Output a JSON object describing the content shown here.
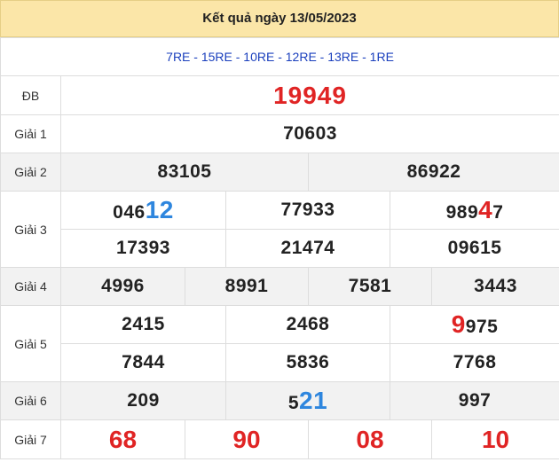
{
  "header": {
    "title": "Kết quả ngày 13/05/2023"
  },
  "codes": "7RE - 15RE - 10RE - 12RE - 13RE - 1RE",
  "prizes": {
    "db": {
      "label": "ĐB",
      "value": "19949"
    },
    "g1": {
      "label": "Giải 1",
      "value": "70603"
    },
    "g2": {
      "label": "Giải 2",
      "values": [
        "83105",
        "86922"
      ]
    },
    "g3": {
      "label": "Giải 3",
      "row1": [
        {
          "main": "046",
          "hl": "12"
        },
        {
          "main": "77933"
        },
        {
          "pre": "989",
          "hl": "4",
          "post": "7"
        }
      ],
      "row2": [
        "17393",
        "21474",
        "09615"
      ]
    },
    "g4": {
      "label": "Giải 4",
      "values": [
        "4996",
        "8991",
        "7581",
        "3443"
      ]
    },
    "g5": {
      "label": "Giải 5",
      "row1": [
        {
          "main": "2415"
        },
        {
          "main": "2468"
        },
        {
          "hl": "9",
          "post": "975"
        }
      ],
      "row2": [
        "7844",
        "5836",
        "7768"
      ]
    },
    "g6": {
      "label": "Giải 6",
      "values": [
        {
          "main": "209"
        },
        {
          "main": "5",
          "hl": "21"
        },
        {
          "main": "997"
        }
      ]
    },
    "g7": {
      "label": "Giải 7",
      "values": [
        "68",
        "90",
        "08",
        "10"
      ]
    }
  },
  "colors": {
    "header_bg": "#fbe6a8",
    "codes_text": "#1a3fbd",
    "red": "#e02424",
    "blue": "#2e86de",
    "row_gray": "#f2f2f2"
  }
}
